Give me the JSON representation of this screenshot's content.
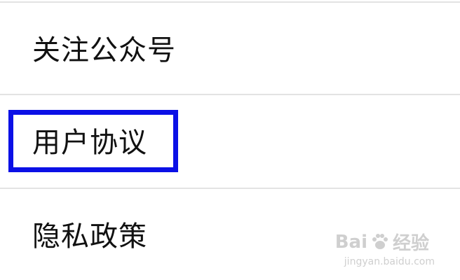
{
  "menu": {
    "items": [
      {
        "label": "关注公众号"
      },
      {
        "label": "用户协议"
      },
      {
        "label": "隐私政策"
      }
    ],
    "highlighted_index": 1
  },
  "watermark": {
    "brand_text": "Bai",
    "brand_suffix": "经验",
    "url": "jingyan.baidu.com"
  },
  "colors": {
    "background": "#ffffff",
    "divider": "#e3e3e3",
    "text": "#111111",
    "highlight_border": "#0b10e6",
    "watermark": "#cfcfcf"
  }
}
